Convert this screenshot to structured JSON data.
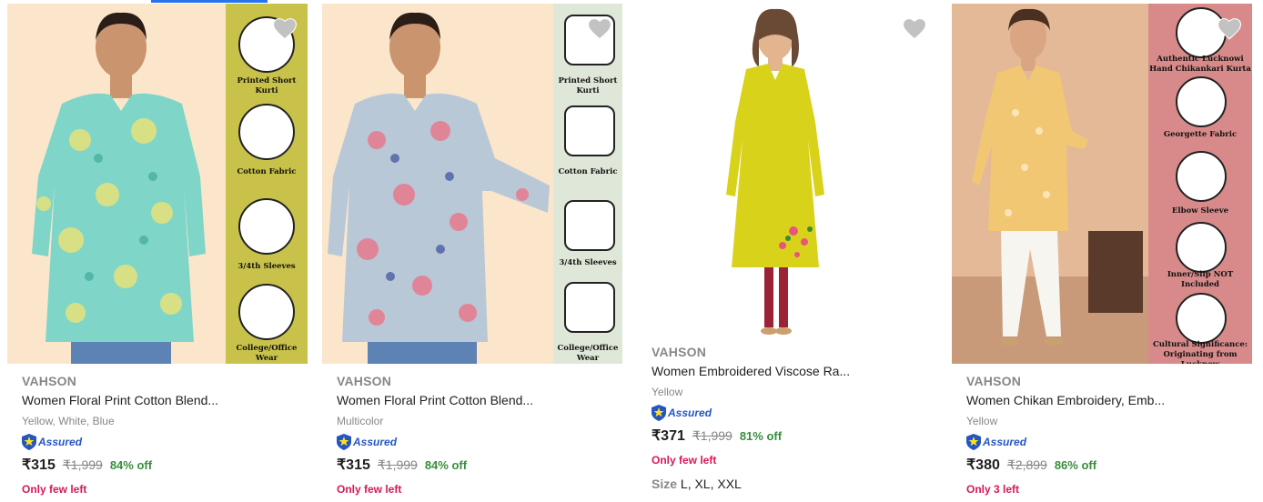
{
  "products": [
    {
      "brand": "VAHSON",
      "title": "Women Floral Print Cotton Blend...",
      "variant": "Yellow, White, Blue",
      "assured": "Assured",
      "price": "₹315",
      "mrp": "₹1,999",
      "discount": "84% off",
      "stock": "Only few left",
      "features": [
        "Printed Short Kurti",
        "Cotton Fabric",
        "3/4th Sleeves",
        "College/Office Wear"
      ],
      "colors": {
        "bg": "#fde9cf",
        "panel": "#c9c24a",
        "dress": "#7fd6c8"
      }
    },
    {
      "brand": "VAHSON",
      "title": "Women Floral Print Cotton Blend...",
      "variant": "Multicolor",
      "assured": "Assured",
      "price": "₹315",
      "mrp": "₹1,999",
      "discount": "84% off",
      "stock": "Only few left",
      "features": [
        "Printed Short Kurti",
        "Cotton Fabric",
        "3/4th Sleeves",
        "College/Office Wear"
      ],
      "colors": {
        "bg": "#fde9cf",
        "panel": "#dfe7d8",
        "dress": "#b9c8d6"
      }
    },
    {
      "brand": "VAHSON",
      "title": "Women Embroidered Viscose Ra...",
      "variant": "Yellow",
      "assured": "Assured",
      "price": "₹371",
      "mrp": "₹1,999",
      "discount": "81% off",
      "stock": "Only few left",
      "size_label": "Size",
      "sizes": "L, XL, XXL",
      "colors": {
        "bg": "#ffffff",
        "dress": "#d9d21a",
        "leggings": "#9c2236"
      }
    },
    {
      "brand": "VAHSON",
      "title": "Women Chikan Embroidery, Emb...",
      "variant": "Yellow",
      "assured": "Assured",
      "price": "₹380",
      "mrp": "₹2,899",
      "discount": "86% off",
      "stock": "Only 3 left",
      "features": [
        "Authentic Lucknowi Hand Chikankari Kurta",
        "Georgette Fabric",
        "Elbow Sleeve",
        "Inner/Slip NOT Included",
        "Cultural Significance: Originating from Lucknow"
      ],
      "colors": {
        "bg": "#e8c6a8",
        "panel": "#d88a8a",
        "dress": "#f2c774"
      }
    }
  ],
  "icons": {
    "wishlist": "heart-icon",
    "assured": "assured-shield-icon"
  }
}
